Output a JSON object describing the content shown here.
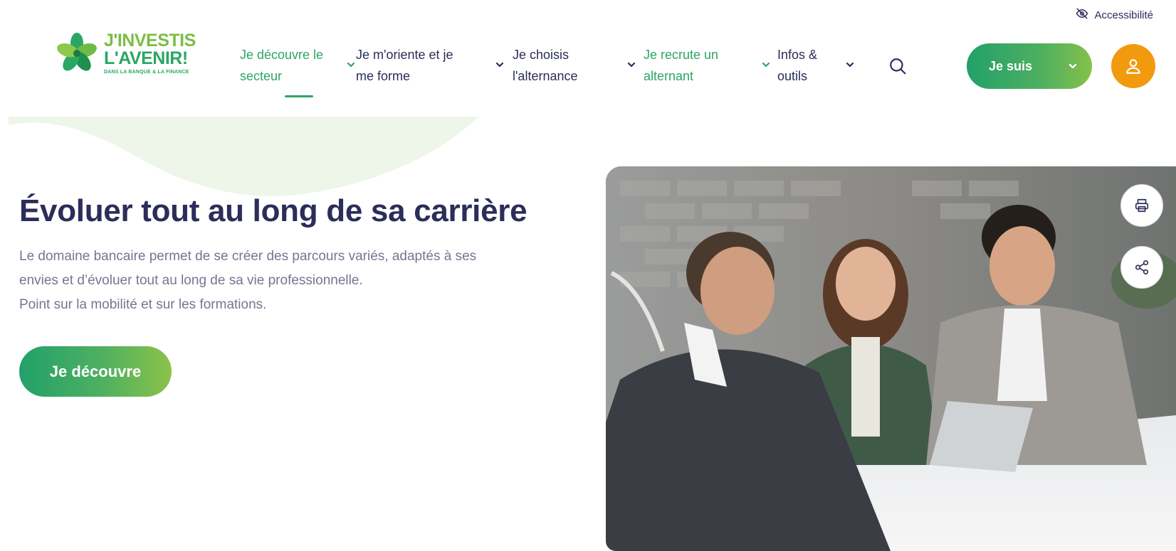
{
  "accessibility": {
    "label": "Accessibilité"
  },
  "logo": {
    "line1": "J'INVESTIS",
    "line2": "L'AVENIR!",
    "tagline": "DANS LA BANQUE & LA FINANCE"
  },
  "nav": {
    "items": [
      {
        "label": "Je découvre le\nsecteur",
        "active": true
      },
      {
        "label": "Je m'oriente et je\nme forme",
        "active": false
      },
      {
        "label": "Je choisis\nl'alternance",
        "active": false
      },
      {
        "label": "Je recrute un\nalternant",
        "active": false
      },
      {
        "label": "Infos &\noutils",
        "active": false
      }
    ]
  },
  "header": {
    "je_suis_label": "Je suis"
  },
  "hero": {
    "title": "Évoluer tout au long de sa carrière",
    "desc_line1": "Le domaine bancaire permet de se créer des parcours variés, adaptés à ses",
    "desc_line2": "envies et d’évoluer tout au long de sa vie professionnelle.",
    "desc_line3": "Point sur la mobilité et sur les formations.",
    "cta_label": "Je découvre"
  },
  "colors": {
    "primary_green": "#2ca665",
    "light_green": "#7cbd44",
    "navy": "#2b2d5a",
    "orange": "#f29a0e",
    "muted_text": "#75768f"
  },
  "icons": [
    "eye-off-icon",
    "chevron-down-icon",
    "search-icon",
    "user-icon",
    "print-icon",
    "share-icon"
  ]
}
